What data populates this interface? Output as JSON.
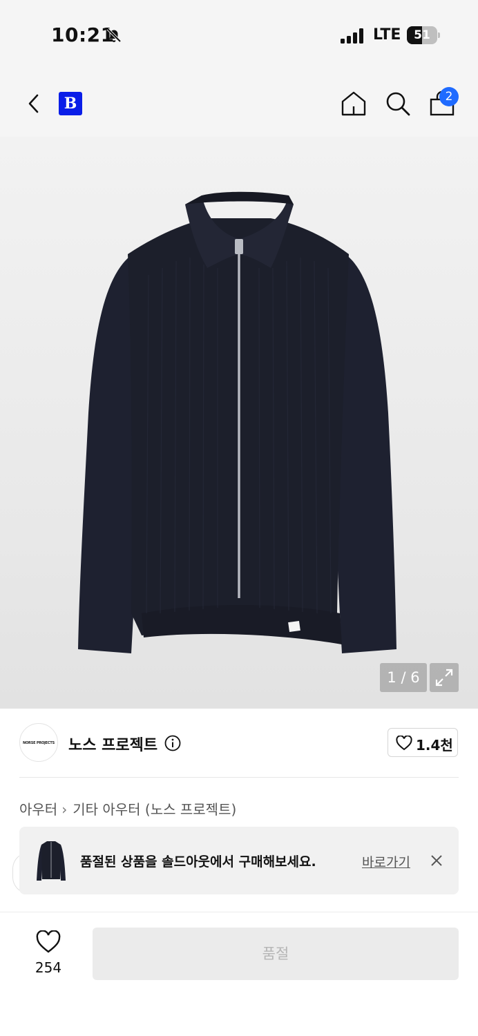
{
  "status_bar": {
    "time": "10:21",
    "network": "LTE",
    "battery_level": "51",
    "battery_fraction": 0.51
  },
  "nav": {
    "brand_logo": "B",
    "cart_count": "2",
    "icons": [
      "chevron-left-icon",
      "home-icon",
      "search-icon",
      "shopping-bag-icon"
    ]
  },
  "gallery": {
    "page_indicator": "1 / 6",
    "current_page": 1,
    "total_pages": 6
  },
  "brand": {
    "logo_text": "NORSE PROJECTS",
    "name": "노스 프로젝트",
    "like_count": "1.4천"
  },
  "breadcrumb": {
    "items": [
      "아우터",
      "기타 아우터 (노스 프로젝트)"
    ]
  },
  "banner": {
    "text": "품절된 상품을 솔드아웃에서 구매해보세요.",
    "link_label": "바로가기"
  },
  "bottom_bar": {
    "wish_count": "254",
    "soldout_label": "품절"
  },
  "colors": {
    "brand_blue": "#0a1ee8",
    "badge_blue": "#1f6bff",
    "header_bg": "#f5f5f5",
    "sweater_navy": "#1c1f2b"
  }
}
